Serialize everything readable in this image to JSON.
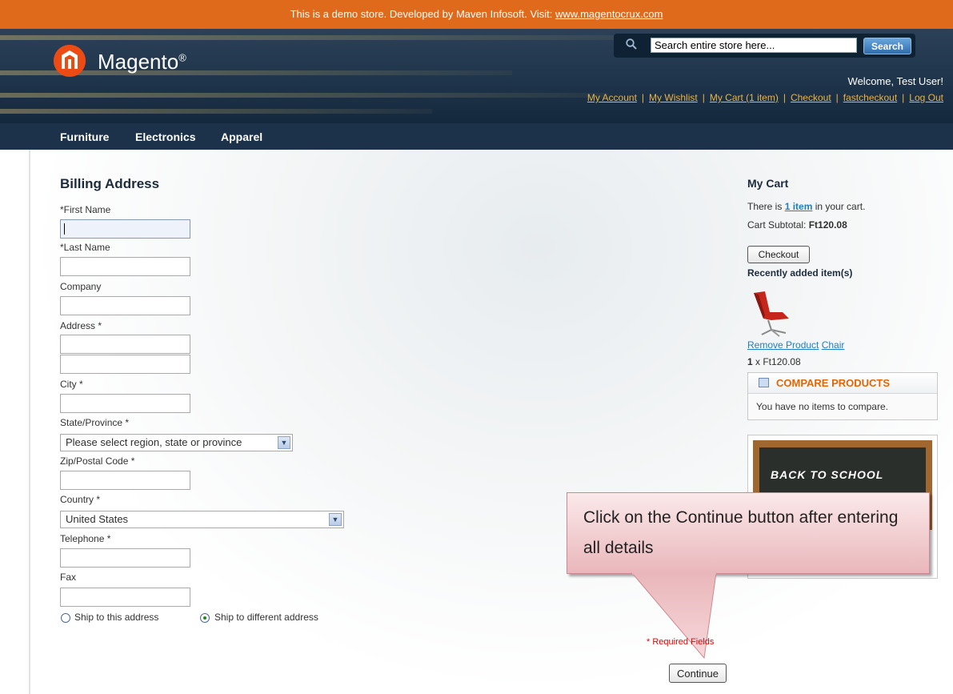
{
  "demo_bar": {
    "text": "This is a demo store. Developed by Maven Infosoft. Visit: ",
    "link": "www.magentocrux.com"
  },
  "header": {
    "logo_text": "Magento",
    "logo_registered": "®",
    "search": {
      "placeholder": "Search entire store here...",
      "value": "Search entire store here...",
      "button": "Search"
    },
    "welcome": "Welcome, Test User!",
    "links": [
      "My Account",
      "My Wishlist",
      "My Cart (1 item)",
      "Checkout",
      "fastcheckout",
      "Log Out"
    ],
    "separator": "|"
  },
  "nav": {
    "items": [
      "Furniture",
      "Electronics",
      "Apparel"
    ]
  },
  "billing": {
    "title": "Billing Address",
    "first_name_label": "*First Name",
    "last_name_label": "*Last Name",
    "company_label": "Company",
    "address_label": "Address *",
    "city_label": "City *",
    "state_label": "State/Province *",
    "state_value": "Please select region, state or province",
    "zip_label": "Zip/Postal Code *",
    "country_label": "Country *",
    "country_value": "United States",
    "telephone_label": "Telephone *",
    "fax_label": "Fax",
    "ship_same_label": "Ship to this address",
    "ship_different_label": "Ship to different address",
    "ship_selected": "different",
    "required_note": "* Required Fields",
    "continue_button": "Continue"
  },
  "sidebar": {
    "cart_title": "My Cart",
    "cart_line_prefix": "There is ",
    "cart_line_link": "1 item",
    "cart_line_suffix": " in your cart.",
    "subtotal_label": "Cart Subtotal: ",
    "subtotal_value": "Ft120.08",
    "checkout_button": "Checkout",
    "recent_title": "Recently added item(s)",
    "remove_link": "Remove Product",
    "product_link": "Chair",
    "qty": "1",
    "price_line": " x Ft120.08",
    "compare_title": "COMPARE PRODUCTS",
    "compare_text": "You have no items to compare.",
    "banner_text": "BACK TO SCHOOL"
  },
  "callout": {
    "text": "Click on the Continue button after entering all details"
  },
  "colors": {
    "demo_bar": "#df6a1c",
    "nav": "#1b324a",
    "link_orange": "#e8b347",
    "compare_orange": "#e26703",
    "callout": "#f2cfd2"
  }
}
